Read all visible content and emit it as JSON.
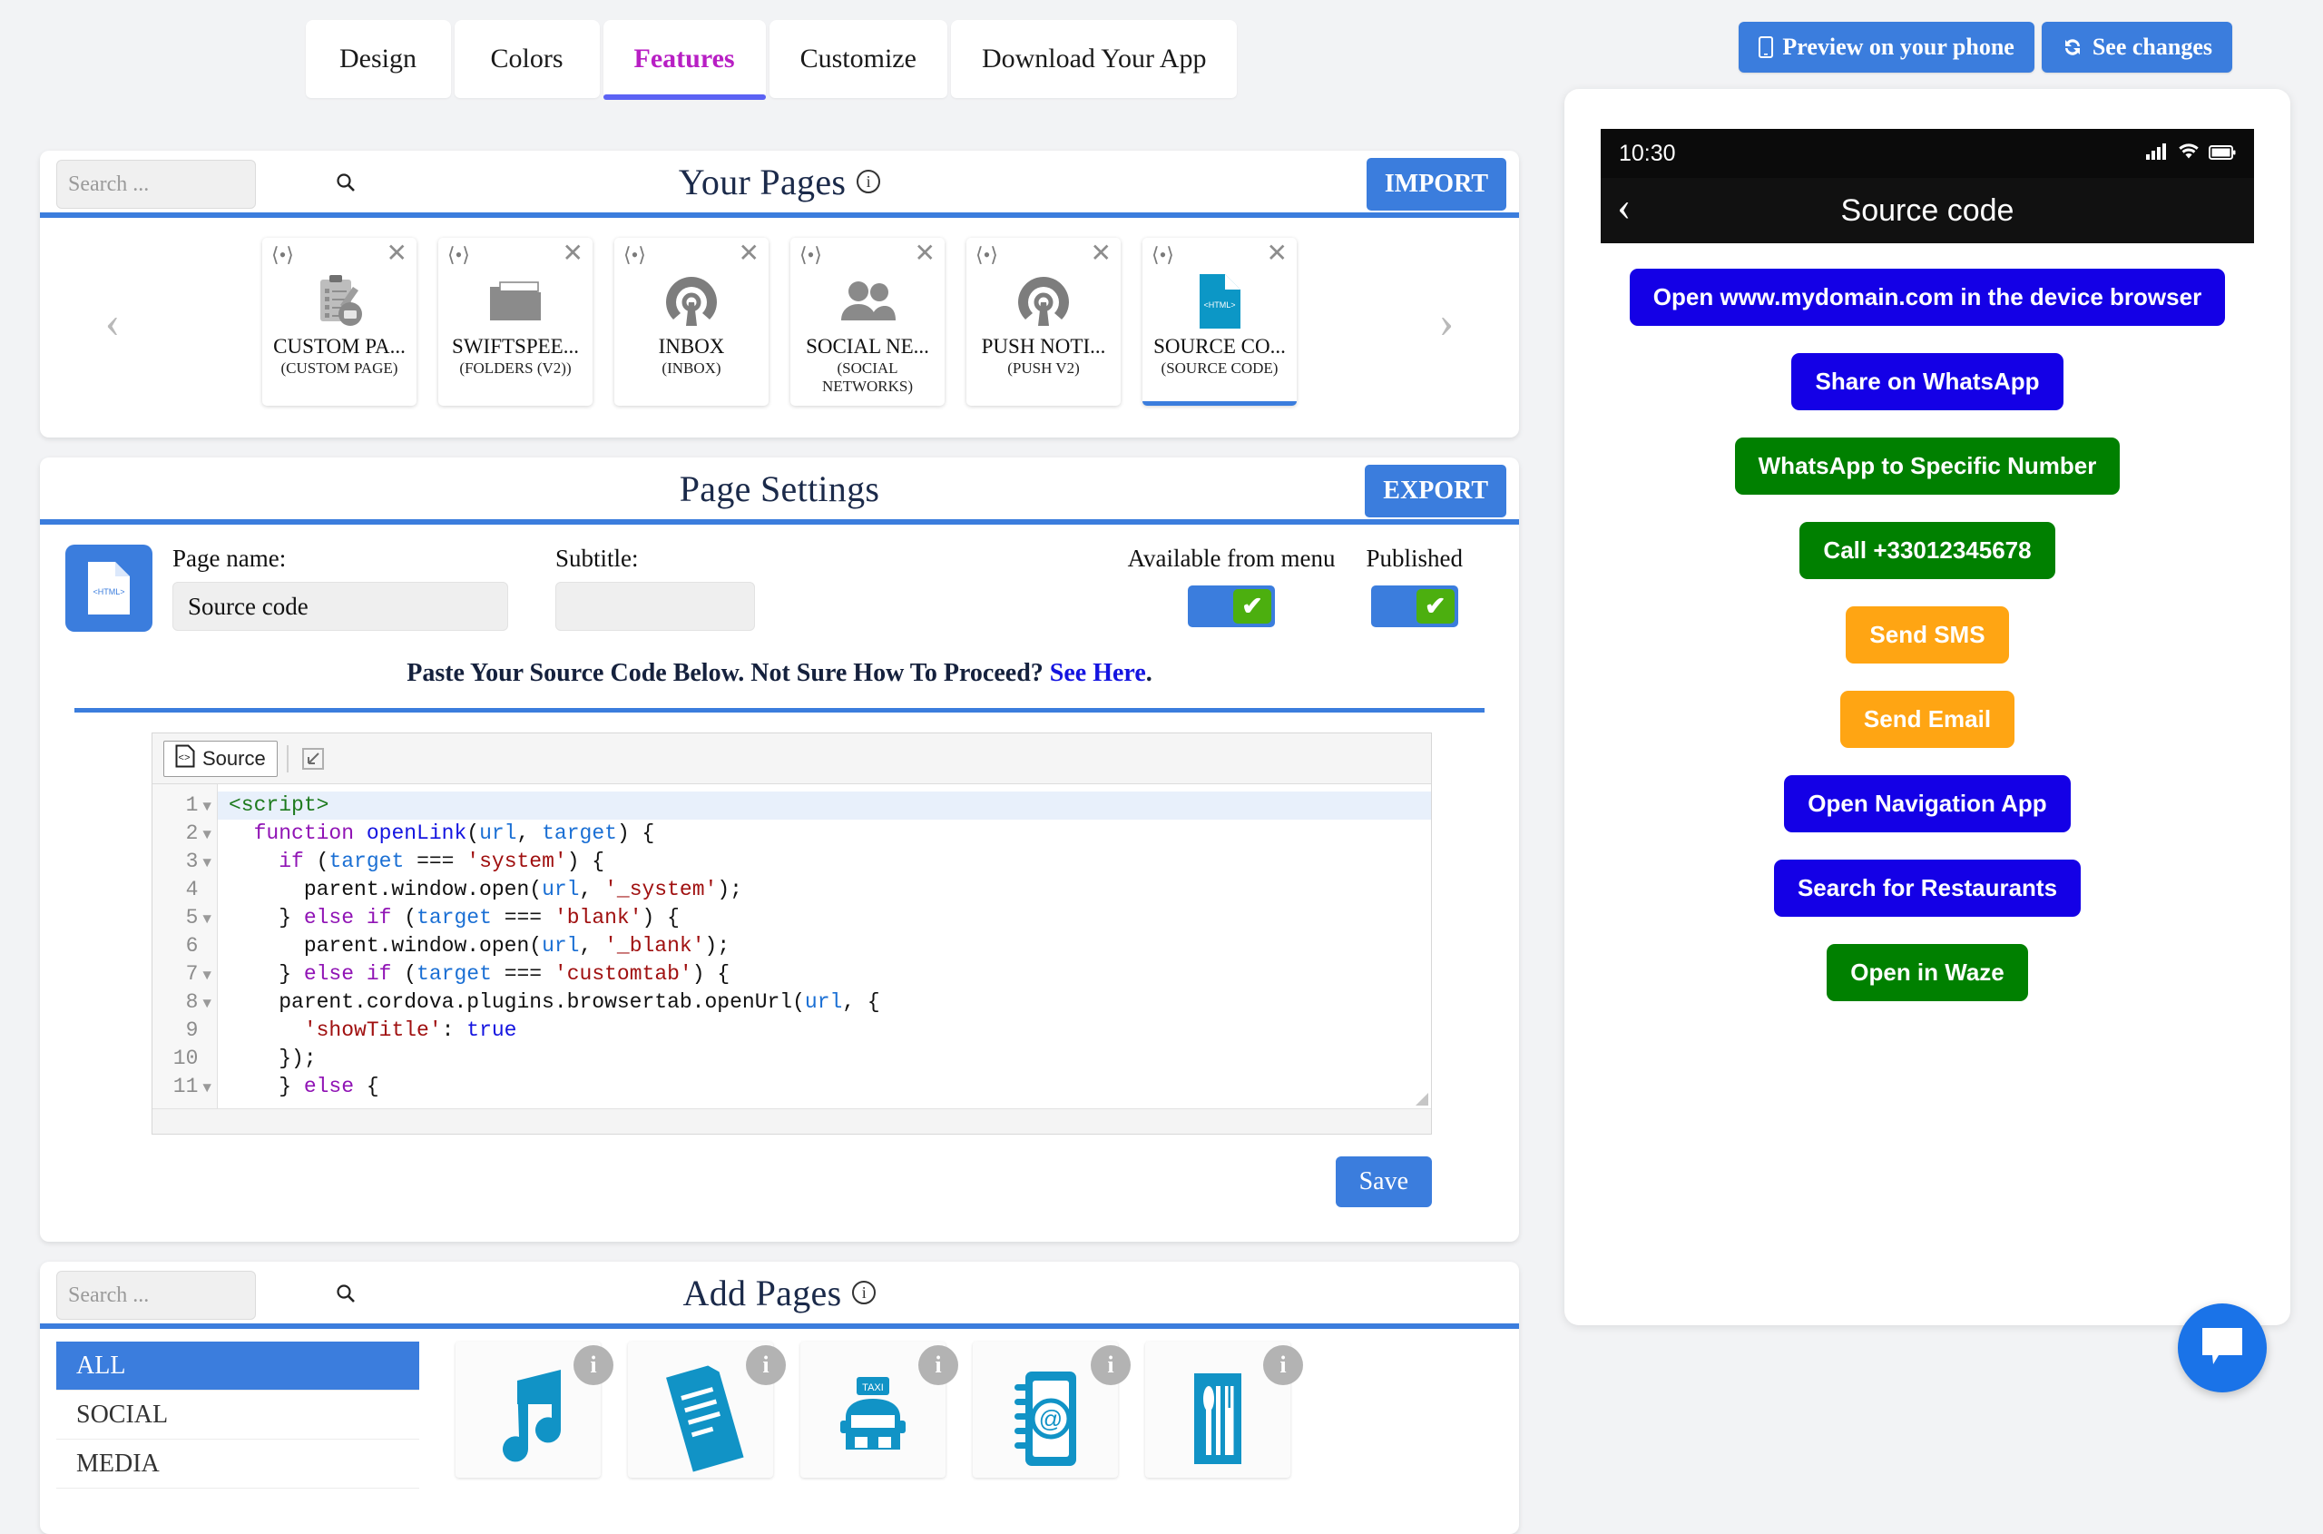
{
  "tabs": [
    {
      "label": "Design",
      "active": false
    },
    {
      "label": "Colors",
      "active": false
    },
    {
      "label": "Features",
      "active": true
    },
    {
      "label": "Customize",
      "active": false
    },
    {
      "label": "Download Your App",
      "active": false
    }
  ],
  "top_actions": [
    {
      "label": "Preview on your phone",
      "icon": "mobile-phone-icon"
    },
    {
      "label": "See changes",
      "icon": "refresh-icon"
    }
  ],
  "your_pages": {
    "title": "Your Pages",
    "search_placeholder": "Search ...",
    "import_label": "IMPORT",
    "cards": [
      {
        "name": "CUSTOM PA...",
        "type": "(CUSTOM PAGE)",
        "icon": "clipboard-cart-icon",
        "selected": false
      },
      {
        "name": "SWIFTSPEE...",
        "type": "(FOLDERS (V2))",
        "icon": "folder-icon",
        "selected": false
      },
      {
        "name": "INBOX",
        "type": "(INBOX)",
        "icon": "broadcast-icon",
        "selected": false
      },
      {
        "name": "SOCIAL NE...",
        "type": "(SOCIAL NETWORKS)",
        "icon": "people-icon",
        "selected": false
      },
      {
        "name": "PUSH NOTI...",
        "type": "(PUSH V2)",
        "icon": "broadcast-icon",
        "selected": false
      },
      {
        "name": "SOURCE CO...",
        "type": "(SOURCE CODE)",
        "icon": "html-file-icon",
        "selected": true
      }
    ]
  },
  "page_settings": {
    "title": "Page Settings",
    "export_label": "EXPORT",
    "page_name_label": "Page name:",
    "page_name_value": "Source code",
    "subtitle_label": "Subtitle:",
    "subtitle_value": "",
    "available_from_menu_label": "Available from menu",
    "available_from_menu_on": true,
    "published_label": "Published",
    "published_on": true,
    "notice_text": "Paste Your Source Code Below. Not Sure How To Proceed? ",
    "notice_link": "See Here",
    "notice_tail": ".",
    "save_label": "Save"
  },
  "editor": {
    "source_button": "Source",
    "maximize_icon": "maximize-icon",
    "highlighted_line": 1,
    "lines": [
      {
        "n": "1",
        "fold": true,
        "tokens": [
          {
            "t": "<script>",
            "c": "k-tag"
          }
        ]
      },
      {
        "n": "2",
        "fold": true,
        "tokens": [
          {
            "t": "  ",
            "c": ""
          },
          {
            "t": "function ",
            "c": "k-kw"
          },
          {
            "t": "openLink",
            "c": "k-fn"
          },
          {
            "t": "(",
            "c": ""
          },
          {
            "t": "url",
            "c": "k-var"
          },
          {
            "t": ", ",
            "c": ""
          },
          {
            "t": "target",
            "c": "k-var"
          },
          {
            "t": ") {",
            "c": ""
          }
        ]
      },
      {
        "n": "3",
        "fold": true,
        "tokens": [
          {
            "t": "    ",
            "c": ""
          },
          {
            "t": "if",
            "c": "k-kw"
          },
          {
            "t": " (",
            "c": ""
          },
          {
            "t": "target",
            "c": "k-var"
          },
          {
            "t": " === ",
            "c": ""
          },
          {
            "t": "'system'",
            "c": "k-str"
          },
          {
            "t": ") {",
            "c": ""
          }
        ]
      },
      {
        "n": "4",
        "fold": false,
        "tokens": [
          {
            "t": "      parent.window.open(",
            "c": ""
          },
          {
            "t": "url",
            "c": "k-var"
          },
          {
            "t": ", ",
            "c": ""
          },
          {
            "t": "'_system'",
            "c": "k-str"
          },
          {
            "t": ");",
            "c": ""
          }
        ]
      },
      {
        "n": "5",
        "fold": true,
        "tokens": [
          {
            "t": "    } ",
            "c": ""
          },
          {
            "t": "else if",
            "c": "k-kw"
          },
          {
            "t": " (",
            "c": ""
          },
          {
            "t": "target",
            "c": "k-var"
          },
          {
            "t": " === ",
            "c": ""
          },
          {
            "t": "'blank'",
            "c": "k-str"
          },
          {
            "t": ") {",
            "c": ""
          }
        ]
      },
      {
        "n": "6",
        "fold": false,
        "tokens": [
          {
            "t": "      parent.window.open(",
            "c": ""
          },
          {
            "t": "url",
            "c": "k-var"
          },
          {
            "t": ", ",
            "c": ""
          },
          {
            "t": "'_blank'",
            "c": "k-str"
          },
          {
            "t": ");",
            "c": ""
          }
        ]
      },
      {
        "n": "7",
        "fold": true,
        "tokens": [
          {
            "t": "    } ",
            "c": ""
          },
          {
            "t": "else if",
            "c": "k-kw"
          },
          {
            "t": " (",
            "c": ""
          },
          {
            "t": "target",
            "c": "k-var"
          },
          {
            "t": " === ",
            "c": ""
          },
          {
            "t": "'customtab'",
            "c": "k-str"
          },
          {
            "t": ") {",
            "c": ""
          }
        ]
      },
      {
        "n": "8",
        "fold": true,
        "tokens": [
          {
            "t": "    parent.cordova.plugins.browsertab.openUrl(",
            "c": ""
          },
          {
            "t": "url",
            "c": "k-var"
          },
          {
            "t": ", {",
            "c": ""
          }
        ]
      },
      {
        "n": "9",
        "fold": false,
        "tokens": [
          {
            "t": "      ",
            "c": ""
          },
          {
            "t": "'showTitle'",
            "c": "k-str"
          },
          {
            "t": ": ",
            "c": ""
          },
          {
            "t": "true",
            "c": "k-num"
          }
        ]
      },
      {
        "n": "10",
        "fold": false,
        "tokens": [
          {
            "t": "    });",
            "c": ""
          }
        ]
      },
      {
        "n": "11",
        "fold": true,
        "tokens": [
          {
            "t": "    } ",
            "c": ""
          },
          {
            "t": "else",
            "c": "k-kw"
          },
          {
            "t": " {",
            "c": ""
          }
        ]
      }
    ]
  },
  "add_pages": {
    "title": "Add Pages",
    "search_placeholder": "Search ...",
    "categories": [
      {
        "label": "ALL",
        "selected": true
      },
      {
        "label": "SOCIAL",
        "selected": false
      },
      {
        "label": "MEDIA",
        "selected": false
      }
    ],
    "apps": [
      {
        "icon": "music-note-icon"
      },
      {
        "icon": "news-document-icon"
      },
      {
        "icon": "taxi-icon"
      },
      {
        "icon": "contact-email-icon"
      },
      {
        "icon": "restaurant-icon"
      }
    ],
    "info_badge": "i"
  },
  "preview": {
    "status_time": "10:30",
    "status_icons": [
      "signal-icon",
      "wifi-icon",
      "battery-icon"
    ],
    "nav_title": "Source code",
    "back_icon": "chevron-left-icon",
    "buttons": [
      {
        "label": "Open www.mydomain.com in the device browser",
        "color": "#1400e6"
      },
      {
        "label": "Share on WhatsApp",
        "color": "#1400e6"
      },
      {
        "label": "WhatsApp to Specific Number",
        "color": "#008000"
      },
      {
        "label": "Call +33012345678",
        "color": "#008000"
      },
      {
        "label": "Send SMS",
        "color": "#ffa513"
      },
      {
        "label": "Send Email",
        "color": "#ffa513"
      },
      {
        "label": "Open Navigation App",
        "color": "#1400e6"
      },
      {
        "label": "Search for Restaurants",
        "color": "#1400e6"
      },
      {
        "label": "Open in Waze",
        "color": "#008000"
      }
    ]
  },
  "chat_fab": {
    "icon": "chat-bubble-icon",
    "color": "#1a73e8"
  },
  "colors": {
    "accent_blue": "#3b7ddd",
    "active_tab": "#b81fc4",
    "tab_underline": "#5b62f4",
    "toggle_on": "#4caf0f",
    "app_icon_cyan": "#1193c6"
  }
}
